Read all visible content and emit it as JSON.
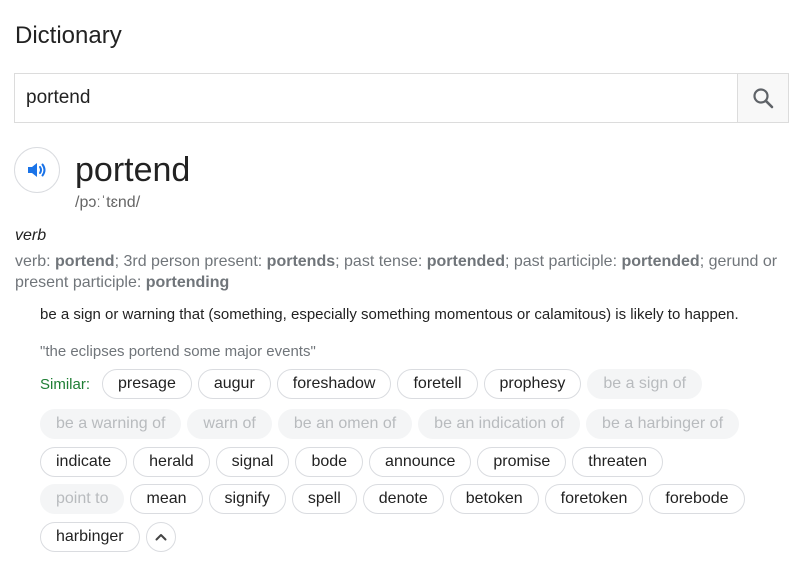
{
  "header": {
    "title": "Dictionary"
  },
  "search": {
    "value": "portend",
    "icon": "search-icon"
  },
  "entry": {
    "word": "portend",
    "phonetic": "/pɔːˈtɛnd/",
    "part_of_speech": "verb",
    "forms": {
      "verb_label": "verb:",
      "verb": "portend",
      "third_person_label": "3rd person present:",
      "third_person": "portends",
      "past_tense_label": "past tense:",
      "past_tense": "portended",
      "past_participle_label": "past participle:",
      "past_participle": "portended",
      "gerund_label": "gerund or present participle:",
      "gerund": "portending"
    },
    "definition": "be a sign or warning that (something, especially something momentous or calamitous) is likely to happen.",
    "example": "\"the eclipses portend some major events\"",
    "similar_label": "Similar:",
    "similar": [
      {
        "text": "presage",
        "faded": false
      },
      {
        "text": "augur",
        "faded": false
      },
      {
        "text": "foreshadow",
        "faded": false
      },
      {
        "text": "foretell",
        "faded": false
      },
      {
        "text": "prophesy",
        "faded": false
      },
      {
        "text": "be a sign of",
        "faded": true
      },
      {
        "text": "be a warning of",
        "faded": true
      },
      {
        "text": "warn of",
        "faded": true
      },
      {
        "text": "be an omen of",
        "faded": true
      },
      {
        "text": "be an indication of",
        "faded": true
      },
      {
        "text": "be a harbinger of",
        "faded": true
      },
      {
        "text": "indicate",
        "faded": false
      },
      {
        "text": "herald",
        "faded": false
      },
      {
        "text": "signal",
        "faded": false
      },
      {
        "text": "bode",
        "faded": false
      },
      {
        "text": "announce",
        "faded": false
      },
      {
        "text": "promise",
        "faded": false
      },
      {
        "text": "threaten",
        "faded": false
      },
      {
        "text": "point to",
        "faded": true
      },
      {
        "text": "mean",
        "faded": false
      },
      {
        "text": "signify",
        "faded": false
      },
      {
        "text": "spell",
        "faded": false
      },
      {
        "text": "denote",
        "faded": false
      },
      {
        "text": "betoken",
        "faded": false
      },
      {
        "text": "foretoken",
        "faded": false
      },
      {
        "text": "forebode",
        "faded": false
      },
      {
        "text": "harbinger",
        "faded": false
      }
    ]
  },
  "colors": {
    "similar_label": "#1e7e34",
    "speaker": "#1a73e8",
    "muted": "#70757a"
  }
}
